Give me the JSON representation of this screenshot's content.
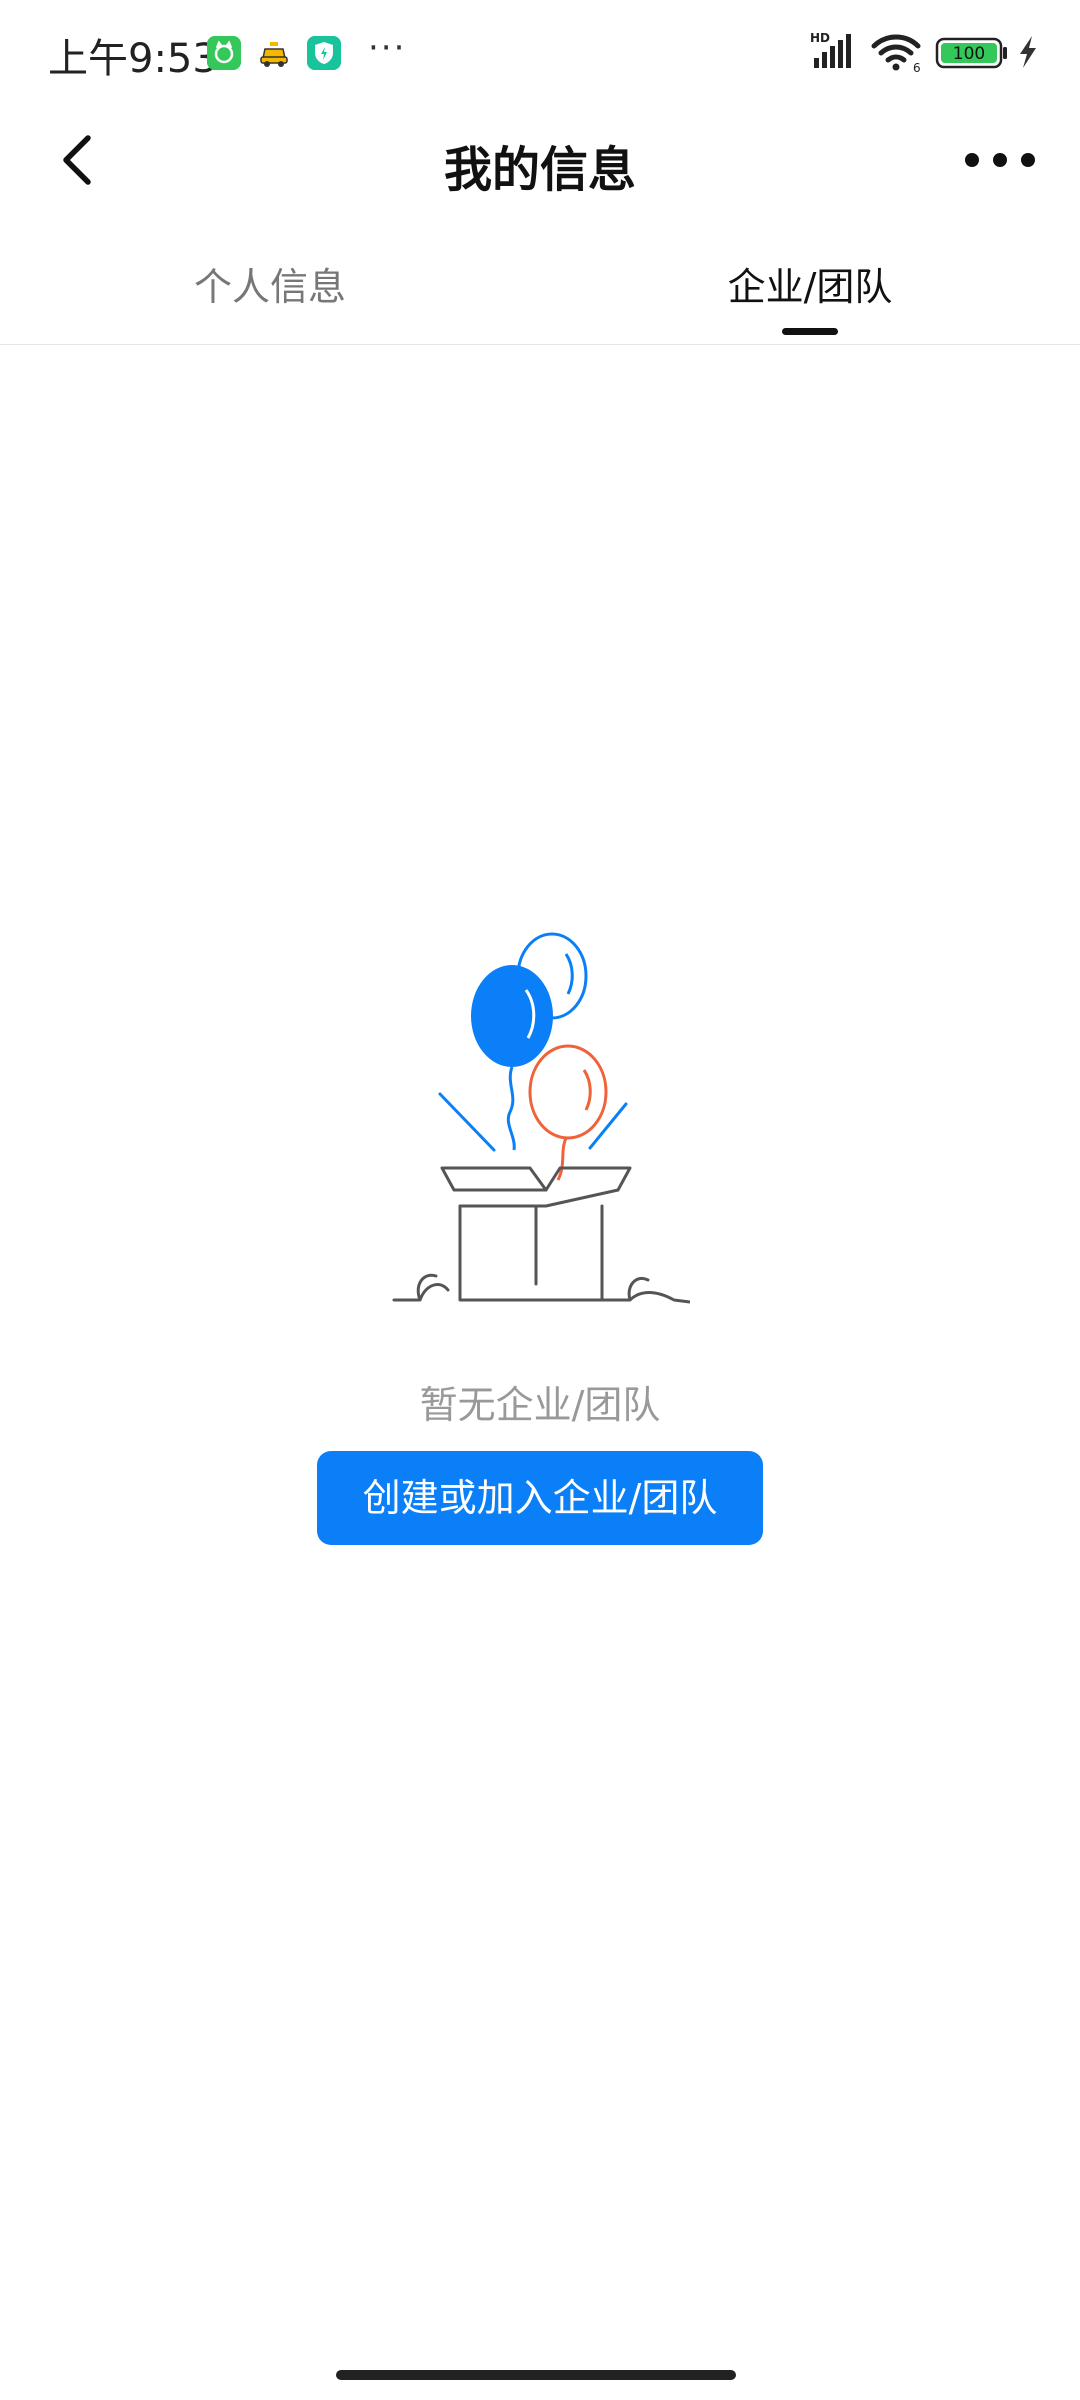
{
  "status_bar": {
    "time": "上午9:53",
    "more_dots": "···",
    "network_label": "HD",
    "wifi_label": "6",
    "battery_level": "100",
    "battery_color": "#34c759"
  },
  "nav": {
    "title": "我的信息"
  },
  "tabs": [
    {
      "label": "个人信息",
      "active": false
    },
    {
      "label": "企业/团队",
      "active": true
    }
  ],
  "empty_state": {
    "message": "暂无企业/团队",
    "action_label": "创建或加入企业/团队",
    "accent_color": "#0a7ff7",
    "balloon_colors": [
      "#0a7ff7",
      "#f0623a"
    ]
  }
}
